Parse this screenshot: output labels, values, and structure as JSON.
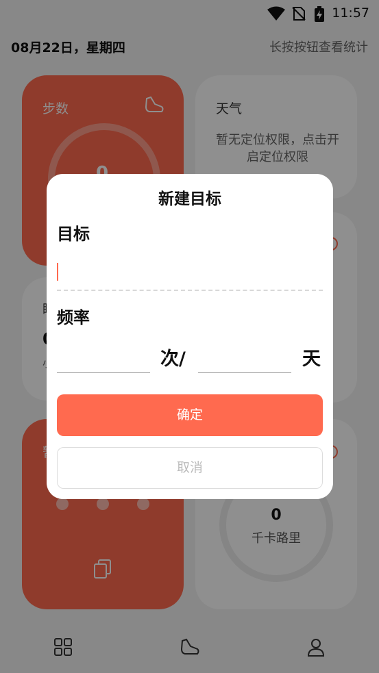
{
  "status_bar": {
    "time": "11:57",
    "icons": [
      "wifi-icon",
      "no-sim-icon",
      "battery-charging-icon"
    ]
  },
  "header": {
    "date": "08月22日，星期四",
    "hint": "长按按钮查看统计"
  },
  "cards": {
    "steps": {
      "title": "步数",
      "value": "0",
      "icon": "shoe-icon",
      "color": "#ff6a4f"
    },
    "weather": {
      "title": "天气",
      "message": "暂无定位权限，点击开启定位权限"
    },
    "partial_mid_left": {
      "title": "睡",
      "value": "0",
      "sub": "小"
    },
    "partial_bottom_left": {
      "title": "暂",
      "icon": "copy-icon"
    },
    "calories": {
      "value": "0",
      "unit": "千卡路里"
    }
  },
  "dialog": {
    "title": "新建目标",
    "goal_label": "目标",
    "goal_value": "",
    "frequency_label": "频率",
    "times_value": "",
    "times_unit": "次/",
    "days_value": "",
    "days_unit": "天",
    "confirm_label": "确定",
    "cancel_label": "取消"
  },
  "bottom_nav": [
    {
      "icon": "grid-icon"
    },
    {
      "icon": "shoe-icon"
    },
    {
      "icon": "person-icon"
    }
  ],
  "colors": {
    "accent": "#ff6a4f",
    "background": "#f3f3f3"
  }
}
